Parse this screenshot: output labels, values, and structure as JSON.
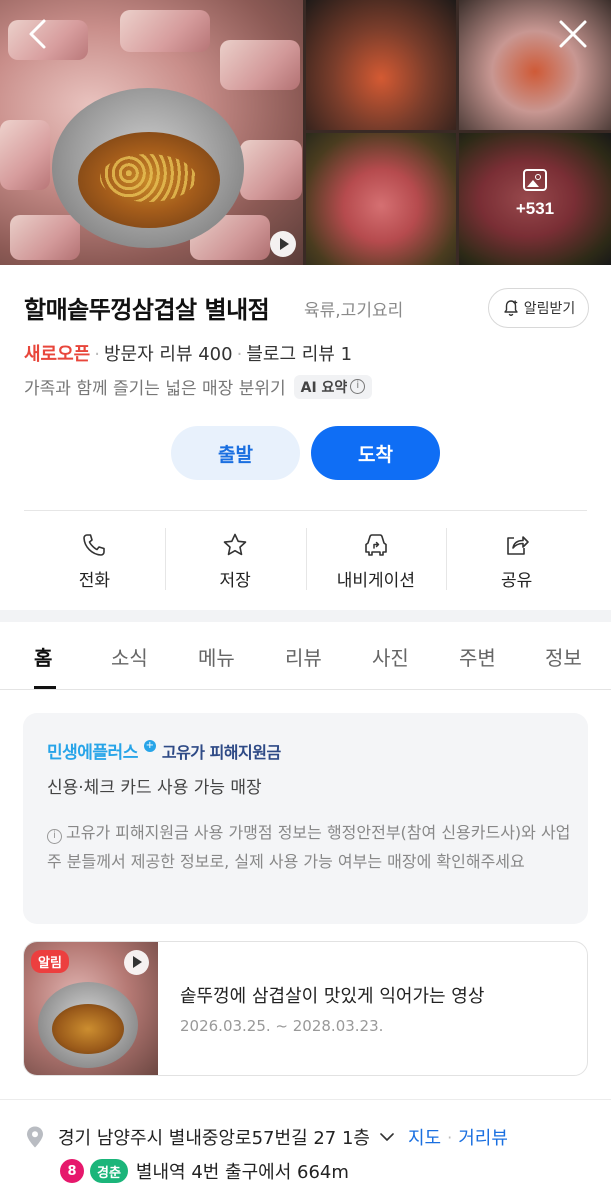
{
  "place": {
    "name": "할매솥뚜껑삼겹살 별내점",
    "category": "육류,고기요리",
    "alert_label": "알림받기"
  },
  "gallery": {
    "more_count": "+531"
  },
  "stats": {
    "status": "새로오픈",
    "visitor_reviews": "방문자 리뷰 400",
    "blog_reviews": "블로그 리뷰 1"
  },
  "summary": {
    "text": "가족과 함께 즐기는 넓은 매장 분위기",
    "ai_label": "AI 요약",
    "ai_info": "i"
  },
  "route": {
    "depart": "출발",
    "arrive": "도착"
  },
  "actions": [
    {
      "label": "전화",
      "icon": "phone-icon"
    },
    {
      "label": "저장",
      "icon": "star-icon"
    },
    {
      "label": "내비게이션",
      "icon": "car-navigation-icon"
    },
    {
      "label": "공유",
      "icon": "share-icon"
    }
  ],
  "tabs": [
    "홈",
    "소식",
    "메뉴",
    "리뷰",
    "사진",
    "주변",
    "정보"
  ],
  "notice": {
    "brand_part1": "민생에플러스",
    "brand_plus": "+",
    "brand_part2": "고유가 피해지원금",
    "subtitle": "신용·체크 카드 사용 가능 매장",
    "info_mark": "i",
    "description": "고유가 피해지원금 사용 가맹점 정보는 행정안전부(참여 신용카드사)와 사업주 분들께서 제공한 정보로, 실제 사용 가능 여부는 매장에 확인해주세요"
  },
  "event": {
    "tag": "알림",
    "title": "솥뚜껑에 삼겹살이 맛있게 익어가는 영상",
    "date_range": "2026.03.25. ~ 2028.03.23."
  },
  "address": {
    "text": "경기 남양주시 별내중앙로57번길 27 1층",
    "map_link": "지도",
    "street_view_link": "거리뷰",
    "subway_line": "8",
    "rail_line": "경춘",
    "station_info": "별내역 4번 출구에서 664m"
  },
  "colors": {
    "accent": "#0f6ef5",
    "status_red": "#e8463b",
    "line8": "#e6186c",
    "gyeongchun": "#1bb57a"
  }
}
